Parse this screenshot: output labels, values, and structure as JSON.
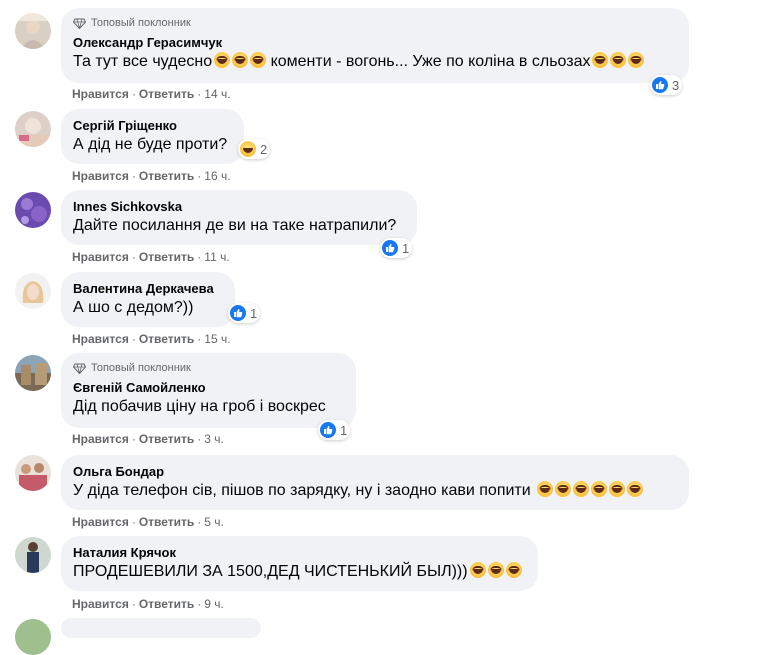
{
  "actions": {
    "like": "Нравится",
    "reply": "Ответить",
    "separator": "·"
  },
  "badge_label": "Топовый поклонник",
  "comments": [
    {
      "author": "Олександр Герасимчук",
      "text": "Та тут все чудесно",
      "text2": " коменти - вогонь... Уже по коліна в сльозах",
      "time": "14 ч.",
      "reaction_count": "3",
      "reaction": "like"
    },
    {
      "author": "Сергій Гріщенко",
      "text": "А дід не буде проти?",
      "time": "16 ч.",
      "reaction_count": "2",
      "reaction": "haha"
    },
    {
      "author": "Innes Sichkovska",
      "text": "Дайте посилання де ви на таке натрапили?",
      "time": "11 ч.",
      "reaction_count": "1",
      "reaction": "like"
    },
    {
      "author": "Валентина Деркачева",
      "text": "А шо с дедом?))",
      "time": "15 ч.",
      "reaction_count": "1",
      "reaction": "like"
    },
    {
      "author": "Євгеній Самойленко",
      "text": "Дід побачив ціну на гроб і воскрес",
      "time": "3 ч.",
      "reaction_count": "1",
      "reaction": "like"
    },
    {
      "author": "Ольга Бондар",
      "text": "У діда телефон сів, пішов по зарядку, ну і заодно кави попити",
      "time": "5 ч."
    },
    {
      "author": "Наталия Крячок",
      "text": "ПРОДЕШЕВИЛИ ЗА 1500,ДЕД ЧИСТЕНЬКИЙ БЫЛ)))",
      "time": "9 ч."
    }
  ]
}
